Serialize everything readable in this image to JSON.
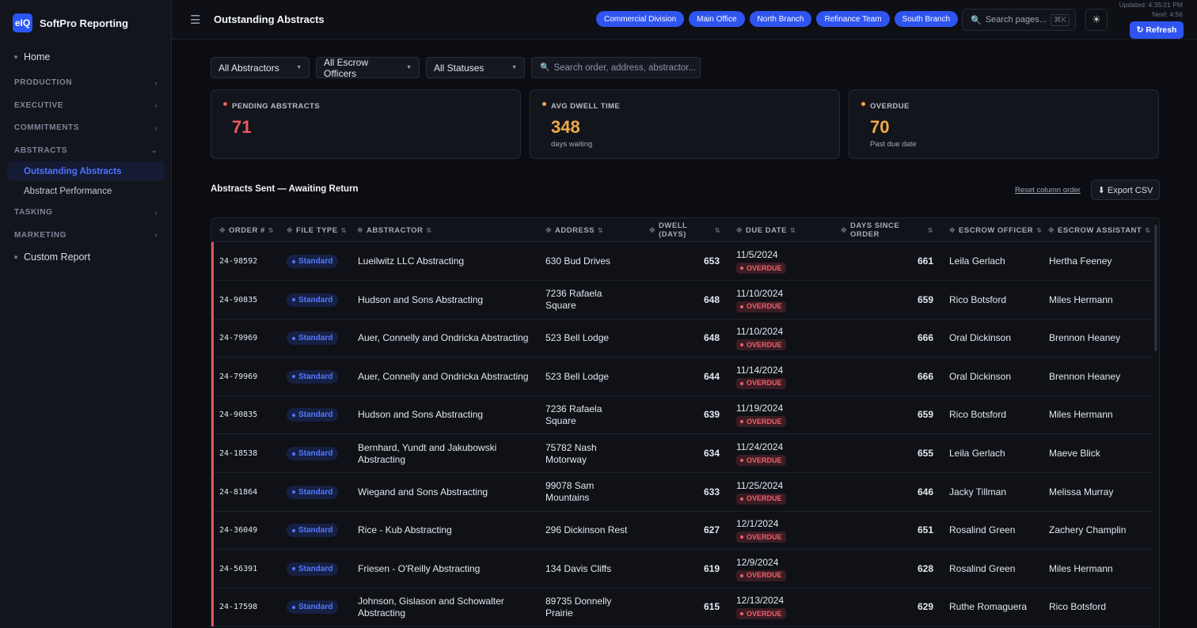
{
  "app": {
    "logo_text": "eIQ",
    "name": "SoftPro Reporting"
  },
  "sidebar": {
    "home": "Home",
    "sections": [
      {
        "label": "PRODUCTION",
        "chevron": "›"
      },
      {
        "label": "EXECUTIVE",
        "chevron": "›"
      },
      {
        "label": "COMMITMENTS",
        "chevron": "›"
      },
      {
        "label": "ABSTRACTS",
        "chevron": "⌄"
      },
      {
        "label": "TASKING",
        "chevron": "›"
      },
      {
        "label": "MARKETING",
        "chevron": "›"
      }
    ],
    "abstract_items": [
      {
        "label": "Outstanding Abstracts",
        "active": true
      },
      {
        "label": "Abstract Performance",
        "active": false
      }
    ],
    "custom_report": "Custom Report"
  },
  "header": {
    "title": "Outstanding Abstracts",
    "menu_icon": "☰",
    "chips": [
      "Commercial Division",
      "Main Office",
      "North Branch",
      "Refinance Team",
      "South Branch"
    ],
    "search_placeholder": "Search pages...",
    "search_shortcut": "⌘K",
    "theme_icon": "☀",
    "updated": "Updated: 4:35:21 PM",
    "next": "Next: 4:56",
    "refresh_label": "↻ Refresh"
  },
  "filters": {
    "abstractors": "All Abstractors",
    "escrow_officers": "All Escrow Officers",
    "statuses": "All Statuses",
    "search_placeholder": "Search order, address, abstractor..."
  },
  "kpis": [
    {
      "label": "PENDING ABSTRACTS",
      "value": "71",
      "sub": "",
      "color": "#ef5a5f"
    },
    {
      "label": "AVG DWELL TIME",
      "value": "348",
      "sub": "days waiting",
      "color": "#f2a848"
    },
    {
      "label": "OVERDUE",
      "value": "70",
      "sub": "Past due date",
      "color": "#f2a848"
    }
  ],
  "table": {
    "title": "Abstracts Sent — Awaiting Return",
    "reset_label": "Reset column order",
    "export_label": "⬇ Export CSV",
    "columns": [
      "ORDER #",
      "FILE TYPE",
      "ABSTRACTOR",
      "ADDRESS",
      "DWELL (DAYS)",
      "DUE DATE",
      "DAYS SINCE ORDER",
      "ESCROW OFFICER",
      "ESCROW ASSISTANT"
    ],
    "overdue_label": "OVERDUE",
    "rows": [
      {
        "order": "24-98592",
        "type": "Standard",
        "abstractor": "Lueilwitz LLC Abstracting",
        "address": "630 Bud Drives",
        "dwell": "653",
        "due": "11/5/2024",
        "since": "661",
        "officer": "Leila Gerlach",
        "assistant": "Hertha Feeney"
      },
      {
        "order": "24-90835",
        "type": "Standard",
        "abstractor": "Hudson and Sons Abstracting",
        "address": "7236 Rafaela Square",
        "dwell": "648",
        "due": "11/10/2024",
        "since": "659",
        "officer": "Rico Botsford",
        "assistant": "Miles Hermann"
      },
      {
        "order": "24-79969",
        "type": "Standard",
        "abstractor": "Auer, Connelly and Ondricka Abstracting",
        "address": "523 Bell Lodge",
        "dwell": "648",
        "due": "11/10/2024",
        "since": "666",
        "officer": "Oral Dickinson",
        "assistant": "Brennon Heaney"
      },
      {
        "order": "24-79969",
        "type": "Standard",
        "abstractor": "Auer, Connelly and Ondricka Abstracting",
        "address": "523 Bell Lodge",
        "dwell": "644",
        "due": "11/14/2024",
        "since": "666",
        "officer": "Oral Dickinson",
        "assistant": "Brennon Heaney"
      },
      {
        "order": "24-90835",
        "type": "Standard",
        "abstractor": "Hudson and Sons Abstracting",
        "address": "7236 Rafaela Square",
        "dwell": "639",
        "due": "11/19/2024",
        "since": "659",
        "officer": "Rico Botsford",
        "assistant": "Miles Hermann"
      },
      {
        "order": "24-18538",
        "type": "Standard",
        "abstractor": "Bernhard, Yundt and Jakubowski Abstracting",
        "address": "75782 Nash Motorway",
        "dwell": "634",
        "due": "11/24/2024",
        "since": "655",
        "officer": "Leila Gerlach",
        "assistant": "Maeve Blick"
      },
      {
        "order": "24-81864",
        "type": "Standard",
        "abstractor": "Wiegand and Sons Abstracting",
        "address": "99078 Sam Mountains",
        "dwell": "633",
        "due": "11/25/2024",
        "since": "646",
        "officer": "Jacky Tillman",
        "assistant": "Melissa Murray"
      },
      {
        "order": "24-36049",
        "type": "Standard",
        "abstractor": "Rice - Kub Abstracting",
        "address": "296 Dickinson Rest",
        "dwell": "627",
        "due": "12/1/2024",
        "since": "651",
        "officer": "Rosalind Green",
        "assistant": "Zachery Champlin"
      },
      {
        "order": "24-56391",
        "type": "Standard",
        "abstractor": "Friesen - O'Reilly Abstracting",
        "address": "134 Davis Cliffs",
        "dwell": "619",
        "due": "12/9/2024",
        "since": "628",
        "officer": "Rosalind Green",
        "assistant": "Miles Hermann"
      },
      {
        "order": "24-17598",
        "type": "Standard",
        "abstractor": "Johnson, Gislason and Schowalter Abstracting",
        "address": "89735 Donnelly Prairie",
        "dwell": "615",
        "due": "12/13/2024",
        "since": "629",
        "officer": "Ruthe Romaguera",
        "assistant": "Rico Botsford"
      }
    ]
  }
}
